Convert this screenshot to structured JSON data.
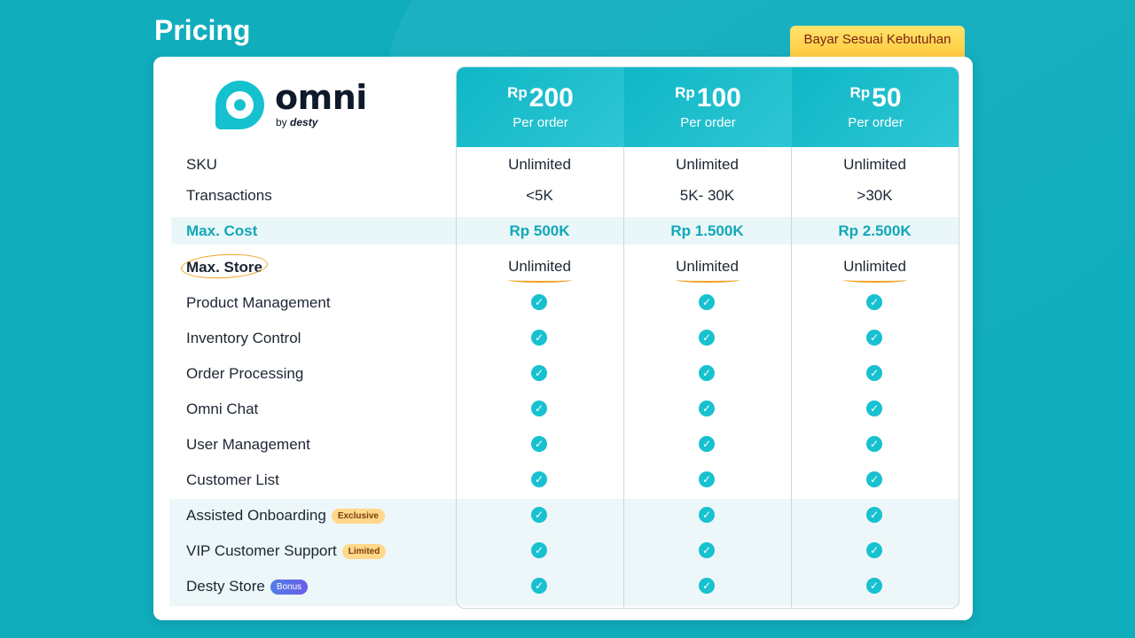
{
  "page_title": "Pricing",
  "badge": "Bayar Sesuai Kebutuhan",
  "logo": {
    "name": "omni",
    "by": "by",
    "brand": "desty"
  },
  "plans": [
    {
      "currency": "Rp",
      "amount": "200",
      "unit": "Per order",
      "sku": "Unlimited",
      "transactions": "<5K",
      "max_cost": "Rp 500K",
      "max_store": "Unlimited"
    },
    {
      "currency": "Rp",
      "amount": "100",
      "unit": "Per order",
      "sku": "Unlimited",
      "transactions": "5K- 30K",
      "max_cost": "Rp 1.500K",
      "max_store": "Unlimited"
    },
    {
      "currency": "Rp",
      "amount": "50",
      "unit": "Per order",
      "sku": "Unlimited",
      "transactions": ">30K",
      "max_cost": "Rp 2.500K",
      "max_store": "Unlimited"
    }
  ],
  "rows": {
    "sku": "SKU",
    "transactions": "Transactions",
    "max_cost": "Max. Cost",
    "max_store": "Max. Store"
  },
  "features": [
    {
      "label": "Product Management",
      "tag": ""
    },
    {
      "label": "Inventory Control",
      "tag": ""
    },
    {
      "label": "Order Processing",
      "tag": ""
    },
    {
      "label": "Omni Chat",
      "tag": ""
    },
    {
      "label": "User Management",
      "tag": ""
    },
    {
      "label": "Customer List",
      "tag": ""
    },
    {
      "label": "Assisted Onboarding",
      "tag": "Exclusive"
    },
    {
      "label": "VIP Customer Support",
      "tag": "Limited"
    },
    {
      "label": "Desty Store",
      "tag": "Bonus"
    }
  ],
  "colors": {
    "background": "#10adbd",
    "accent": "#12a7b8",
    "check": "#18c1d0",
    "highlight": "#f0a020"
  },
  "icons": {
    "check": "check-circle-icon"
  }
}
